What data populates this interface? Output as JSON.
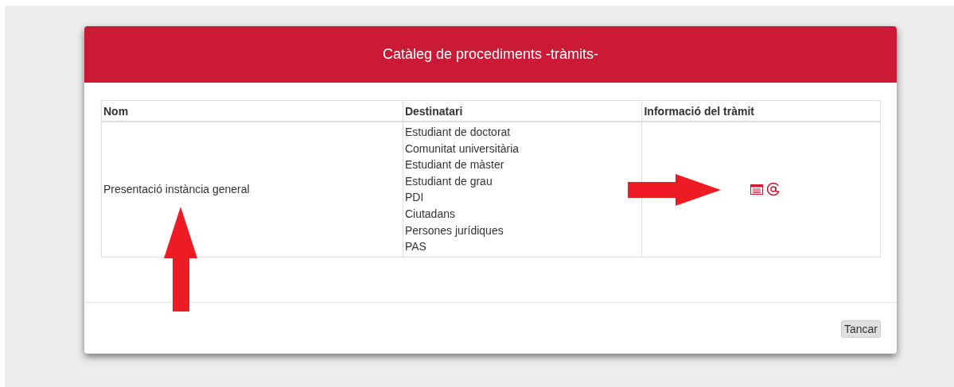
{
  "dialog": {
    "title": "Catàleg de procediments -tràmits-"
  },
  "table": {
    "columns": [
      "Nom",
      "Destinatari",
      "Informació del tràmit"
    ],
    "rows": [
      {
        "name": "Presentació instància general",
        "recipients": [
          "Estudiant de doctorat",
          "Comunitat universitària",
          "Estudiant de màster",
          "Estudiant de grau",
          "PDI",
          "Ciutadans",
          "Persones jurídiques",
          "PAS"
        ]
      }
    ]
  },
  "buttons": [
    "Tancar"
  ]
}
